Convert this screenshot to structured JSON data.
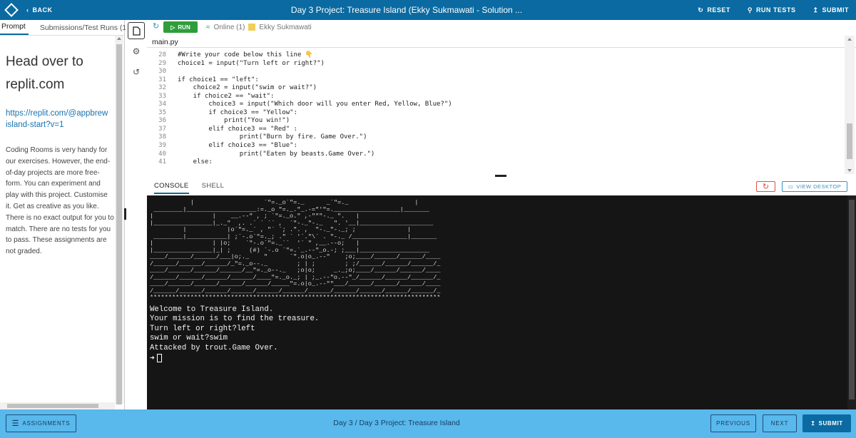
{
  "topbar": {
    "back_label": "BACK",
    "title": "Day 3 Project: Treasure Island (Ekky Sukmawati - Solution ...",
    "reset_label": "RESET",
    "run_tests_label": "RUN TESTS",
    "submit_label": "SUBMIT"
  },
  "left_panel": {
    "tabs": [
      "Prompt",
      "Submissions/Test Runs (1)"
    ],
    "heading_line1": "Head over to",
    "heading_line2": "replit.com",
    "link_line1": "https://replit.com/@appbrew",
    "link_line2": "island-start?v=1",
    "paragraph": "Coding Rooms is very handy for our exercises. However, the end-of-day projects are more free-form. You can experiment and play with this project. Customise it. Get as creative as you like. There is no exact output for you to match. There are no tests for you to pass. These assignments are not graded."
  },
  "editor": {
    "run_label": "RUN",
    "online_label": "Online (1)",
    "user_name": "Ekky Sukmawati",
    "file_name": "main.py",
    "lines": [
      {
        "n": "28",
        "t": "#Write your code below this line 👇"
      },
      {
        "n": "29",
        "t": "choice1 = input(\"Turn left or right?\")"
      },
      {
        "n": "30",
        "t": ""
      },
      {
        "n": "31",
        "t": "if choice1 == \"left\":"
      },
      {
        "n": "32",
        "t": "    choice2 = input(\"swim or wait?\")"
      },
      {
        "n": "33",
        "t": "    if choice2 == \"wait\":"
      },
      {
        "n": "34",
        "t": "        choice3 = input(\"Which door will you enter Red, Yellow, Blue?\")"
      },
      {
        "n": "35",
        "t": "        if choice3 == \"Yellow\":"
      },
      {
        "n": "36",
        "t": "            print(\"You win!\")"
      },
      {
        "n": "37",
        "t": "        elif choice3 == \"Red\" :"
      },
      {
        "n": "38",
        "t": "                print(\"Burn by fire. Game Over.\")"
      },
      {
        "n": "39",
        "t": "        elif choice3 == \"Blue\":"
      },
      {
        "n": "40",
        "t": "                print(\"Eaten by beasts.Game Over.\")"
      },
      {
        "n": "41",
        "t": "    else:"
      }
    ]
  },
  "console": {
    "tab_console": "CONSOLE",
    "tab_shell": "SHELL",
    "view_desktop_label": "VIEW DESKTOP",
    "ascii_art": "           |                   `\"=._o`\"=._      _`\"=._                  |\n ________|___________________:=._o \"=._.\"_.-=\"'\"=.__________________|_______\n|                |    __.--\" , ; `\"=._o.\" ,-\"\"\"-._ \".   |\n|________________|_._\"  ,. .` ` `` ,  `\"-._\"-._   \". '__|____________________\n         |           |o`\"=._` , \"` `; .\". ,  \"-._\"-._; ;              |\n ________|___________| ;`-.o`\"=._; .\" ` '`.\"\\` . \"-._ /_______________|_______\n|                | |o;    `\"-.o`\"=._``  '` \" ,__.--o;   |\n|________________|_| ;     (#) `-.o `\"=.`_.--\"_o.-; ;___|___________________\n____/______/______/___|o;._    \"      `\".o|o_.--\"    ;o;____/______/______/____\n/______/______/______/_\"=._o--._        ; | ;        ; ;/______/______/______/_\n____/______/______/______/__\"=._o--._   ;o|o;     _._;o;____/______/______/____\n/______/______/______/______/____\"=._o._; | ;_.--\"o.--\"_/______/______/______/_\n____/______/______/______/______/_____\"=.o|o_.--\"\"___/______/______/______/____\n/______/______/______/______/______/______/______/______/______/______/______/_\n*******************************************************************************",
    "output_lines": [
      "Welcome to Treasure Island.",
      "Your mission is to find the treasure.",
      "Turn left or right?left",
      "swim or wait?swim",
      "Attacked by trout.Game Over."
    ],
    "prompt_symbol": "➜"
  },
  "bottombar": {
    "assignments_label": "ASSIGNMENTS",
    "title": "Day 3 / Day 3 Project: Treasure Island",
    "previous_label": "PREVIOUS",
    "next_label": "NEXT",
    "submit_label": "SUBMIT"
  },
  "colors": {
    "topbar": "#0a6aa1",
    "bottombar": "#59b8ec",
    "run_button": "#2e9e3a",
    "console_bg": "#151515"
  },
  "icons": [
    "logo-icon",
    "back-chevron-icon",
    "reset-icon",
    "run-tests-icon",
    "submit-upload-icon",
    "file-icon",
    "settings-gear-icon",
    "history-icon",
    "refresh-icon",
    "play-icon",
    "wifi-icon",
    "check-icon",
    "restart-icon",
    "desktop-icon",
    "menu-icon"
  ]
}
